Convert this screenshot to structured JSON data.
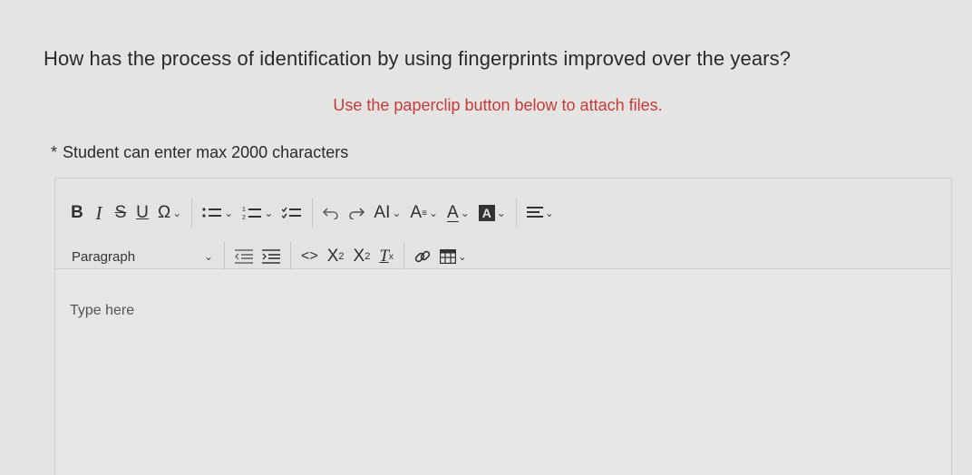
{
  "question": "How has the process of identification by using fingerprints improved over the years?",
  "attach_hint": "Use the paperclip button below to attach files.",
  "char_limit": {
    "asterisk": "*",
    "text": "Student can enter max 2000 characters"
  },
  "toolbar": {
    "bold": "B",
    "italic": "I",
    "strikethrough": "S",
    "underline": "U",
    "special_char": "Ω",
    "ai": "AI",
    "font_size": "A",
    "font_color": "A",
    "bg_color": "A",
    "paragraph_select": "Paragraph",
    "code": "<>",
    "subscript_base": "X",
    "subscript_exp": "2",
    "superscript_base": "X",
    "superscript_exp": "2",
    "clear_format": "T"
  },
  "editor": {
    "placeholder": "Type here"
  },
  "colors": {
    "hint": "#c73a3a",
    "background": "#e4e4e2"
  },
  "icons": [
    "chevron-down-icon",
    "bullet-list-icon",
    "numbered-list-icon",
    "checklist-icon",
    "undo-icon",
    "redo-icon",
    "align-icon",
    "outdent-icon",
    "indent-icon",
    "link-icon",
    "table-icon"
  ]
}
